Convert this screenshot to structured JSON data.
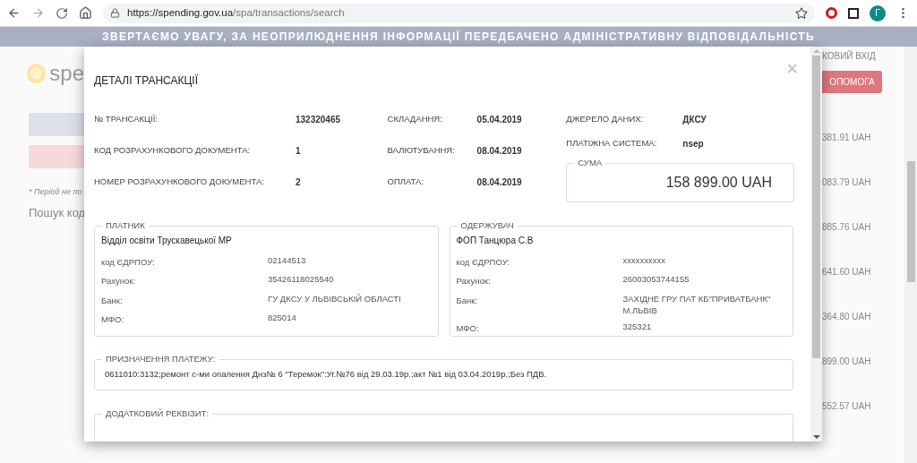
{
  "browser": {
    "url_host": "https://spending.gov.ua",
    "url_path": "/spa/transactions/search",
    "profile_initial": "Г"
  },
  "banner": {
    "text": "ЗВЕРТАЄМО УВАГУ, ЗА НЕОПРИЛЮДНЕННЯ ІНФОРМАЦІЇ ПЕРЕДБАЧЕНО АДМІНІСТРАТИВНУ ВІДПОВІДАЛЬНІСТЬ"
  },
  "background": {
    "logo_text": "spe",
    "note": "* Період не по",
    "search_label": "Пошук код",
    "login_link": "КОВИЙ ВХІД",
    "help_button": "ОПОМОГА",
    "amounts": [
      "381.91 UAH",
      "083.79 UAH",
      "885.76 UAH",
      "641.60 UAH",
      "364.80 UAH",
      "899.00 UAH",
      "552.57 UAH"
    ]
  },
  "modal": {
    "title": "ДЕТАЛІ ТРАНСАКЦІЇ",
    "close": "×",
    "columns": [
      {
        "items": [
          {
            "label": "№ ТРАНСАКЦІЇ:",
            "value": "132320465"
          },
          {
            "label": "КОД РОЗРАХУНКОВОГО ДОКУМЕНТА:",
            "value": "1"
          },
          {
            "label": "НОМЕР РОЗРАХУНКОВОГО ДОКУМЕНТА:",
            "value": "2"
          }
        ]
      },
      {
        "items": [
          {
            "label": "СКЛАДАННЯ:",
            "value": "05.04.2019"
          },
          {
            "label": "ВАЛЮТУВАННЯ:",
            "value": "08.04.2019"
          },
          {
            "label": "ОПЛАТА:",
            "value": "08.04.2019"
          }
        ]
      },
      {
        "items": [
          {
            "label": "ДЖЕРЕЛО ДАНИХ:",
            "value": "ДКСУ"
          },
          {
            "label": "ПЛАТІЖНА СИСТЕМА:",
            "value": "nsep"
          }
        ]
      }
    ],
    "sum": {
      "legend": "СУМА",
      "value": "158 899.00 UAH"
    },
    "parties": [
      {
        "legend": "ПЛАТНИК",
        "name": "Відділ освіти Трускавецької МР",
        "rows": [
          {
            "label": "код ЄДРПОУ:",
            "value": "02144513"
          },
          {
            "label": "Рахунок:",
            "value": "35426118025540"
          },
          {
            "label": "Банк:",
            "value": "ГУ ДКСУ У ЛЬВІВСЬКІЙ ОБЛАСТІ"
          },
          {
            "label": "МФО:",
            "value": "825014"
          }
        ]
      },
      {
        "legend": "ОДЕРЖУВАЧ",
        "name": "ФОП Танцюра С.В",
        "rows": [
          {
            "label": "код ЄДРПОУ:",
            "value": "xxxxxxxxxx"
          },
          {
            "label": "Рахунок:",
            "value": "26003053744155"
          },
          {
            "label": "Банк:",
            "value": "ЗАХІДНЕ ГРУ ПАТ КБ\"ПРИВАТБАНК\" М.ЛЬВІВ"
          },
          {
            "label": "МФО:",
            "value": "325321"
          }
        ]
      }
    ],
    "purpose": {
      "legend": "ПРИЗНАЧЕННЯ ПЛАТЕЖУ:",
      "text": "0611010:3132;ремонт с-ми опалення Днз№ 6 \"Теремок\":Уг.№76 від 29.03.19р.;акт №1 від 03.04.2019р.;Без ПДВ."
    },
    "extra": {
      "legend": "ДОДАТКОВИЙ РЕКВІЗИТ:"
    }
  }
}
